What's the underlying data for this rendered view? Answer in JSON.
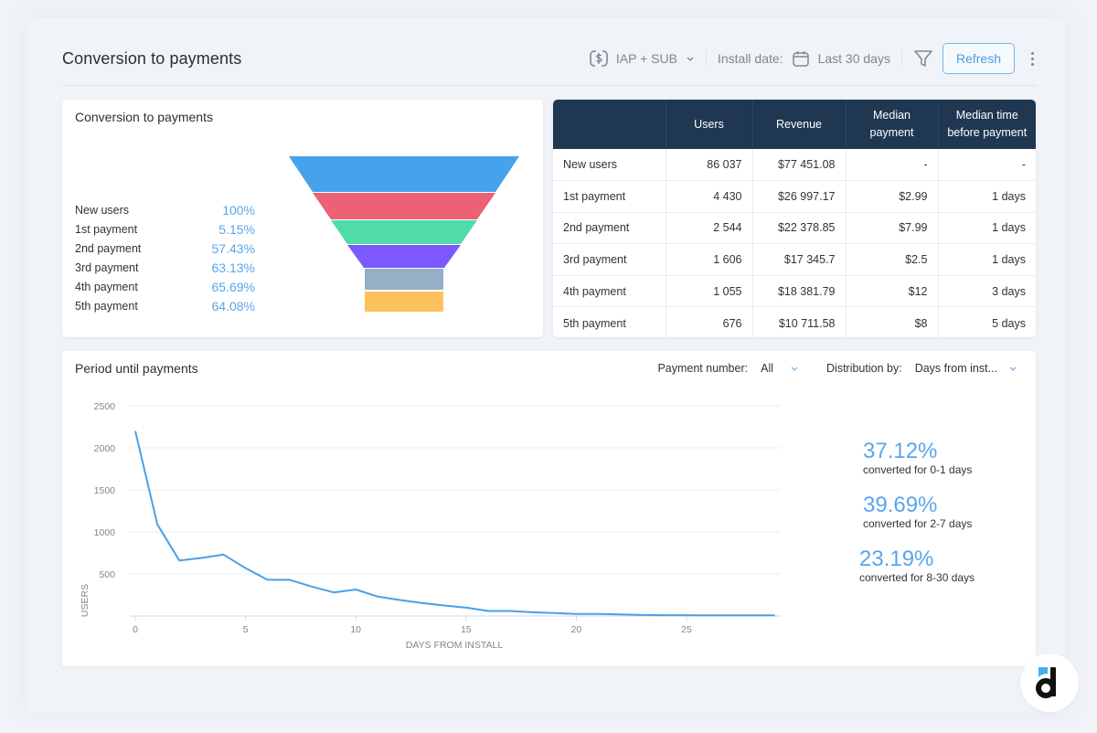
{
  "header": {
    "title": "Conversion to payments",
    "revenue_type": "IAP + SUB",
    "install_date_label": "Install date:",
    "install_date_value": "Last 30 days",
    "refresh_label": "Refresh"
  },
  "funnel": {
    "title": "Conversion to payments",
    "colors": [
      "#46a2ea",
      "#ec6173",
      "#50dba8",
      "#7b59ff",
      "#94afc6",
      "#fdc25c"
    ],
    "rows": [
      {
        "label": "New users",
        "value": "100%"
      },
      {
        "label": "1st payment",
        "value": "5.15%"
      },
      {
        "label": "2nd payment",
        "value": "57.43%"
      },
      {
        "label": "3rd payment",
        "value": "63.13%"
      },
      {
        "label": "4th payment",
        "value": "65.69%"
      },
      {
        "label": "5th payment",
        "value": "64.08%"
      }
    ]
  },
  "table": {
    "headers": [
      "",
      "Users",
      "Revenue",
      "Median payment",
      "Median time before payment"
    ],
    "header_lines": [
      [
        "",
        ""
      ],
      [
        "Users",
        ""
      ],
      [
        "Revenue",
        ""
      ],
      [
        "Median",
        "payment"
      ],
      [
        "Median time",
        "before payment"
      ]
    ],
    "rows": [
      [
        "New users",
        "86 037",
        "$77 451.08",
        "-",
        "-"
      ],
      [
        "1st payment",
        "4 430",
        "$26 997.17",
        "$2.99",
        "1 days"
      ],
      [
        "2nd payment",
        "2 544",
        "$22 378.85",
        "$7.99",
        "1 days"
      ],
      [
        "3rd payment",
        "1 606",
        "$17 345.7",
        "$2.5",
        "1 days"
      ],
      [
        "4th payment",
        "1 055",
        "$18 381.79",
        "$12",
        "3 days"
      ],
      [
        "5th payment",
        "676",
        "$10 711.58",
        "$8",
        "5 days"
      ]
    ]
  },
  "period": {
    "title": "Period until payments",
    "payment_number_label": "Payment number:",
    "payment_number_value": "All",
    "distribution_label": "Distribution by:",
    "distribution_value": "Days from inst...",
    "stats": [
      {
        "value": "37.12%",
        "label": "converted for 0-1 days"
      },
      {
        "value": "39.69%",
        "label": "converted for 2-7 days"
      },
      {
        "value": "23.19%",
        "label": "converted for 8-30 days"
      }
    ]
  },
  "chart_data": {
    "type": "line",
    "title": "Period until payments",
    "xlabel": "DAYS FROM INSTALL",
    "ylabel": "USERS",
    "x": [
      0,
      1,
      2,
      3,
      4,
      5,
      6,
      7,
      8,
      9,
      10,
      11,
      12,
      13,
      14,
      15,
      16,
      17,
      18,
      19,
      20,
      21,
      22,
      23,
      24,
      25,
      26,
      27,
      28,
      29
    ],
    "series": [
      {
        "name": "Users",
        "color": "#4aa0e6",
        "values": [
          2200,
          1090,
          660,
          690,
          730,
          570,
          430,
          430,
          350,
          280,
          315,
          230,
          190,
          155,
          125,
          100,
          60,
          60,
          45,
          35,
          25,
          25,
          18,
          12,
          10,
          10,
          8,
          8,
          8,
          8
        ]
      }
    ],
    "xticks": [
      0,
      5,
      10,
      15,
      20,
      25
    ],
    "yticks": [
      500,
      1000,
      1500,
      2000,
      2500
    ],
    "xlim": [
      0,
      29
    ],
    "ylim": [
      0,
      2500
    ],
    "grid": true
  }
}
